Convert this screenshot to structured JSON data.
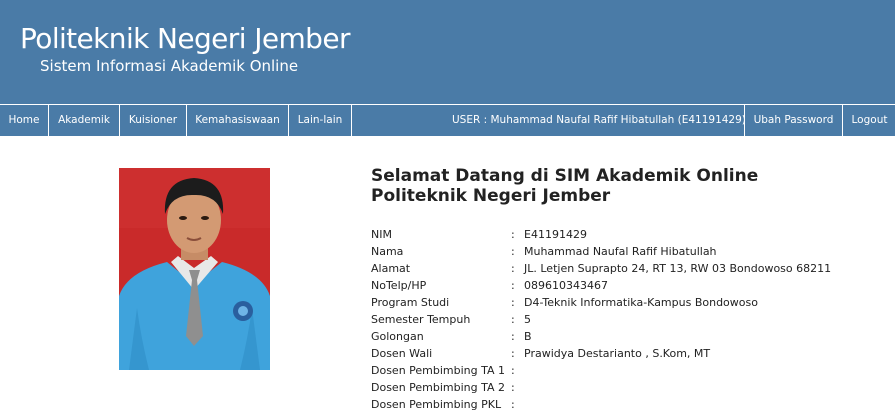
{
  "header": {
    "title": "Politeknik Negeri Jember",
    "subtitle": "Sistem Informasi Akademik Online"
  },
  "nav": {
    "items": [
      "Home",
      "Akademik",
      "Kuisioner",
      "Kemahasiswaan",
      "Lain-lain"
    ],
    "user_label": "USER : Muhammad Naufal Rafif Hibatullah (E41191429)",
    "change_password": "Ubah Password",
    "logout": "Logout"
  },
  "welcome": {
    "line1": "Selamat Datang di SIM Akademik Online",
    "line2": "Politeknik Negeri Jember"
  },
  "student": {
    "rows": [
      {
        "label": "NIM",
        "value": "E41191429"
      },
      {
        "label": "Nama",
        "value": "Muhammad Naufal Rafif Hibatullah"
      },
      {
        "label": "Alamat",
        "value": "JL. Letjen Suprapto 24, RT 13, RW 03 Bondowoso 68211"
      },
      {
        "label": "NoTelp/HP",
        "value": "089610343467"
      },
      {
        "label": "Program Studi",
        "value": "D4-Teknik Informatika-Kampus Bondowoso"
      },
      {
        "label": "Semester Tempuh",
        "value": "5"
      },
      {
        "label": "Golongan",
        "value": "B"
      },
      {
        "label": "Dosen Wali",
        "value": "Prawidya Destarianto , S.Kom, MT"
      },
      {
        "label": "Dosen Pembimbing TA 1",
        "value": ""
      },
      {
        "label": "Dosen Pembimbing TA 2",
        "value": ""
      },
      {
        "label": "Dosen Pembimbing PKL",
        "value": ""
      }
    ],
    "separator": ":"
  },
  "colors": {
    "brand": "#4a7ba7",
    "photo_background": "#c92a2a",
    "jacket": "#3fa3dc"
  }
}
